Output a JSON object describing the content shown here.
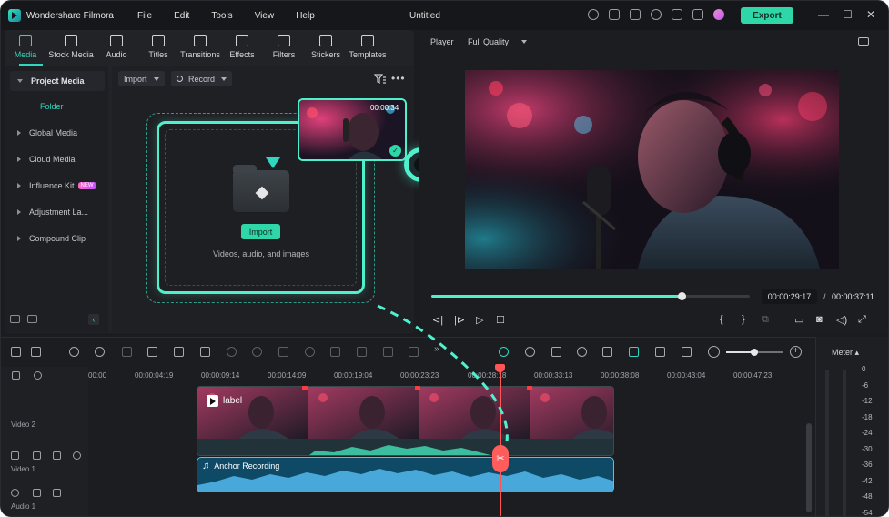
{
  "titlebar": {
    "app_name": "Wondershare Filmora",
    "menu": [
      "File",
      "Edit",
      "Tools",
      "View",
      "Help"
    ],
    "doc_title": "Untitled",
    "export_label": "Export"
  },
  "toolbar": {
    "tools": [
      "Media",
      "Stock Media",
      "Audio",
      "Titles",
      "Transitions",
      "Effects",
      "Filters",
      "Stickers",
      "Templates"
    ]
  },
  "sidebar": {
    "project_media": "Project Media",
    "folder": "Folder",
    "items": [
      "Global Media",
      "Cloud Media",
      "Influence Kit",
      "Adjustment La...",
      "Compound Clip"
    ],
    "new_badge": "NEW"
  },
  "media": {
    "import_dropdown": "Import",
    "record_dropdown": "Record",
    "import_button": "Import",
    "hint": "Videos, audio, and images",
    "thumb_duration": "00:00:34"
  },
  "player": {
    "label": "Player",
    "quality": "Full Quality",
    "current_time": "00:00:29:17",
    "separator": "/",
    "total_time": "00:00:37:11",
    "progress": 0.786
  },
  "timeline": {
    "ticks": [
      "00:00",
      "00:00:04:19",
      "00:00:09:14",
      "00:00:14:09",
      "00:00:19:04",
      "00:00:23:23",
      "00:00:28:18",
      "00:00:33:13",
      "00:00:38:08",
      "00:00:43:04",
      "00:00:47:23"
    ],
    "tracks": {
      "video2": "Video 2",
      "video1": "Video 1",
      "audio1": "Audio 1"
    },
    "video_clip_label": "label",
    "audio_clip_label": "Anchor Recording",
    "zoom": 0.5
  },
  "meter": {
    "label": "Meter",
    "scale": [
      "0",
      "-6",
      "-12",
      "-18",
      "-24",
      "-30",
      "-36",
      "-42",
      "-48",
      "-54"
    ]
  },
  "colors": {
    "accent": "#2fd6c0",
    "export": "#2fd6a8",
    "playhead": "#ff5555",
    "audio_clip": "#4fc4ef"
  }
}
